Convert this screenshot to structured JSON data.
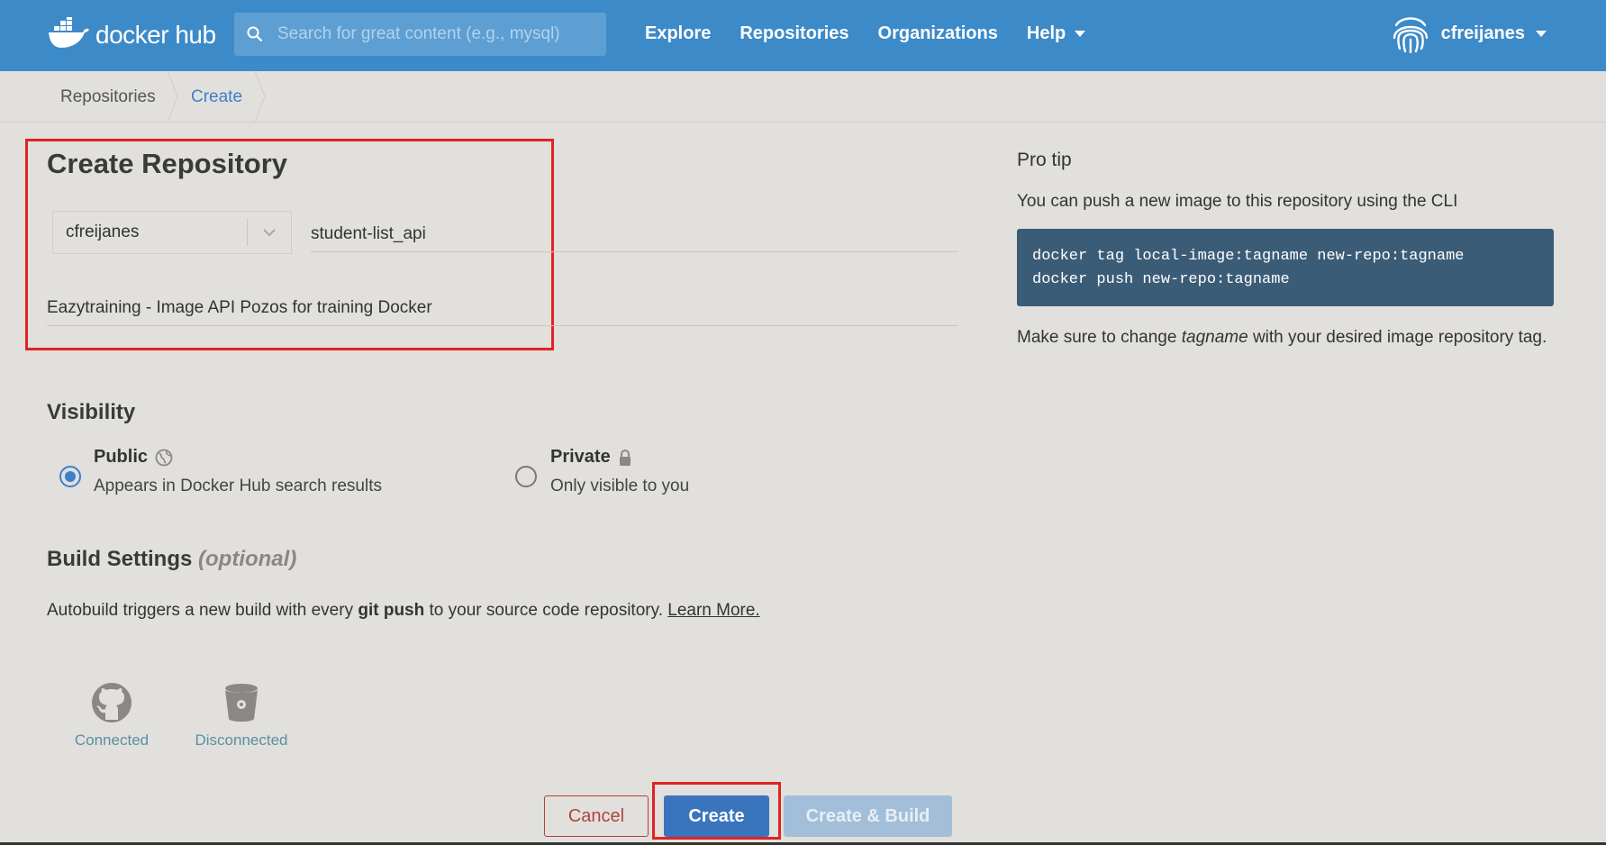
{
  "header": {
    "logo_text": "docker hub",
    "search_placeholder": "Search for great content (e.g., mysql)",
    "nav": [
      "Explore",
      "Repositories",
      "Organizations",
      "Help"
    ],
    "username": "cfreijanes"
  },
  "breadcrumb": [
    "Repositories",
    "Create"
  ],
  "form": {
    "title": "Create Repository",
    "namespace": "cfreijanes",
    "repo_name": "student-list_api",
    "description": "Eazytraining - Image API Pozos for training Docker"
  },
  "visibility": {
    "title": "Visibility",
    "public_label": "Public",
    "public_desc": "Appears in Docker Hub search results",
    "private_label": "Private",
    "private_desc": "Only visible to you",
    "selected": "public"
  },
  "build": {
    "title": "Build Settings",
    "optional": "(optional)",
    "text_before": "Autobuild triggers a new build with every ",
    "text_bold": "git push",
    "text_after": " to your source code repository. ",
    "learn_more": "Learn More.",
    "github_status": "Connected",
    "bitbucket_status": "Disconnected"
  },
  "buttons": {
    "cancel": "Cancel",
    "create": "Create",
    "create_build": "Create & Build"
  },
  "pro_tip": {
    "title": "Pro tip",
    "text": "You can push a new image to this repository using the CLI",
    "code_line1": "docker tag local-image:tagname new-repo:tagname",
    "code_line2": "docker push new-repo:tagname",
    "note_before": "Make sure to change ",
    "note_em": "tagname",
    "note_after": " with your desired image repository tag."
  },
  "colors": {
    "header": "#3d8ac8",
    "page_bg": "#e1e0dc",
    "primary_button": "#3a74bd",
    "highlight": "#e02323"
  }
}
